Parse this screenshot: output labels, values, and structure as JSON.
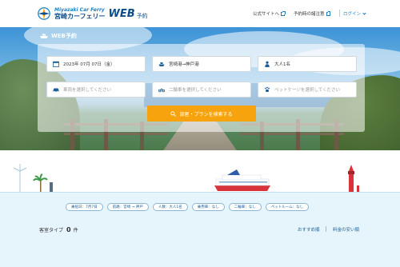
{
  "header": {
    "logo_en": "Miyazaki Car Ferry",
    "logo_ja": "宮崎カーフェリー",
    "logo_web": "WEB",
    "logo_yoyaku": "予約",
    "nav_official": "公式サイトへ",
    "nav_notes": "予約時の諸注意",
    "nav_login": "ログイン"
  },
  "hero": {
    "title": "WEB予約"
  },
  "form": {
    "date": "2023年 07月 07日（金）",
    "route": "宮崎港→神戸港",
    "passengers": "大人1名",
    "car_placeholder": "車両を選択してください",
    "bike_placeholder": "二輪車を選択してください",
    "pet_placeholder": "ペットケージを選択してください",
    "search_label": "部屋・プランを検索する"
  },
  "filters": [
    "乗船日：7月7日",
    "航路：宮崎 → 神戸",
    "人数：大人1名",
    "乗用車：なし",
    "二輪車：なし",
    "ペットルーム：なし"
  ],
  "results": {
    "label": "客室タイプ",
    "count": "0",
    "unit": "件",
    "sort_recommended": "おすすめ順",
    "sort_price": "料金の安い順"
  },
  "colors": {
    "brand": "#0d4d8a",
    "accent": "#f6a30d",
    "link": "#1b7fc4"
  }
}
